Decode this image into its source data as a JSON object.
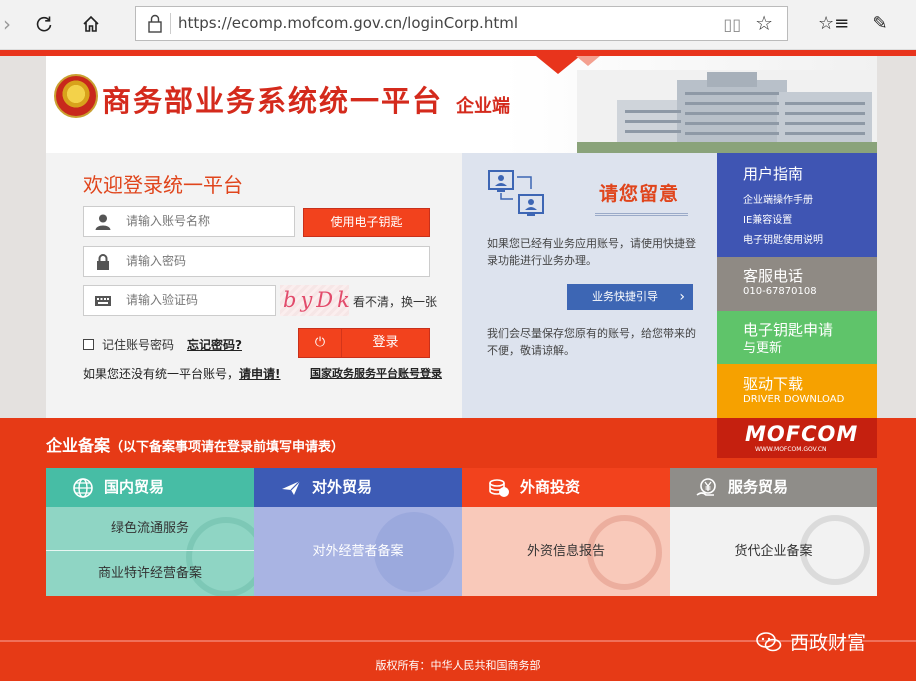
{
  "browser": {
    "url": "https://ecomp.mofcom.gov.cn/loginCorp.html"
  },
  "header": {
    "title": "商务部业务系统统一平台",
    "subtitle": "企业端"
  },
  "login": {
    "title": "欢迎登录统一平台",
    "account_placeholder": "请输入账号名称",
    "password_placeholder": "请输入密码",
    "captcha_placeholder": "请输入验证码",
    "ekey_button": "使用电子钥匙",
    "captcha_text": "byDk",
    "captcha_refresh": "看不清，换一张",
    "remember_label": "记住账号密码",
    "forgot_link": "忘记密码?",
    "login_button": "登录",
    "no_account_text": "如果您还没有统一平台账号，",
    "register_link": "请申请!",
    "gov_link": "国家政务服务平台账号登录"
  },
  "notice": {
    "title": "请您留意",
    "para1": "如果您已经有业务应用账号，请使用快捷登录功能进行业务办理。",
    "button": "业务快捷引导",
    "para2": "我们会尽量保存您原有的账号，给您带来的不便，敬请谅解。"
  },
  "right_links": {
    "guide": {
      "title": "用户指南",
      "items": [
        "企业端操作手册",
        "IE兼容设置",
        "电子钥匙使用说明"
      ]
    },
    "service": {
      "title": "客服电话",
      "phone": "010-67870108"
    },
    "ekey": {
      "title_line1": "电子钥匙申请",
      "title_line2": "与更新"
    },
    "driver": {
      "title": "驱动下载",
      "subtitle": "DRIVER DOWNLOAD"
    },
    "mofcom": {
      "logo": "MOFCOM",
      "url": "WWW.MOFCOM.GOV.CN"
    }
  },
  "filing": {
    "title": "企业备案",
    "note": "（以下备案事项请在登录前填写申请表）",
    "categories": [
      {
        "name": "国内贸易",
        "items": [
          "绿色流通服务",
          "商业特许经营备案"
        ]
      },
      {
        "name": "对外贸易",
        "items": [
          "对外经营者备案"
        ]
      },
      {
        "name": "外商投资",
        "items": [
          "外资信息报告"
        ]
      },
      {
        "name": "服务贸易",
        "items": [
          "货代企业备案"
        ]
      }
    ]
  },
  "footer": {
    "copyright": "版权所有：中华人民共和国商务部",
    "watermark": "西政财富"
  },
  "colors": {
    "brand_red": "#e63a16",
    "domestic": "#47bda5",
    "foreign": "#3d5bb5",
    "investment": "#f2421d",
    "service": "#8f8d89"
  }
}
